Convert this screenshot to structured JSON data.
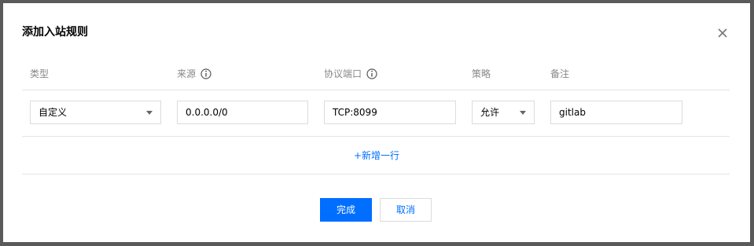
{
  "dialog": {
    "title": "添加入站规则",
    "close_icon": "close-icon"
  },
  "columns": {
    "type": "类型",
    "source": "来源",
    "port": "协议端口",
    "policy": "策略",
    "remark": "备注"
  },
  "row": {
    "type_value": "自定义",
    "source_value": "0.0.0.0/0",
    "port_value": "TCP:8099",
    "policy_value": "允许",
    "remark_value": "gitlab"
  },
  "add_row_label": "+新增一行",
  "buttons": {
    "done": "完成",
    "cancel": "取消"
  },
  "colors": {
    "accent": "#006eff",
    "header_text": "#888888",
    "border": "#dcdcdc"
  }
}
